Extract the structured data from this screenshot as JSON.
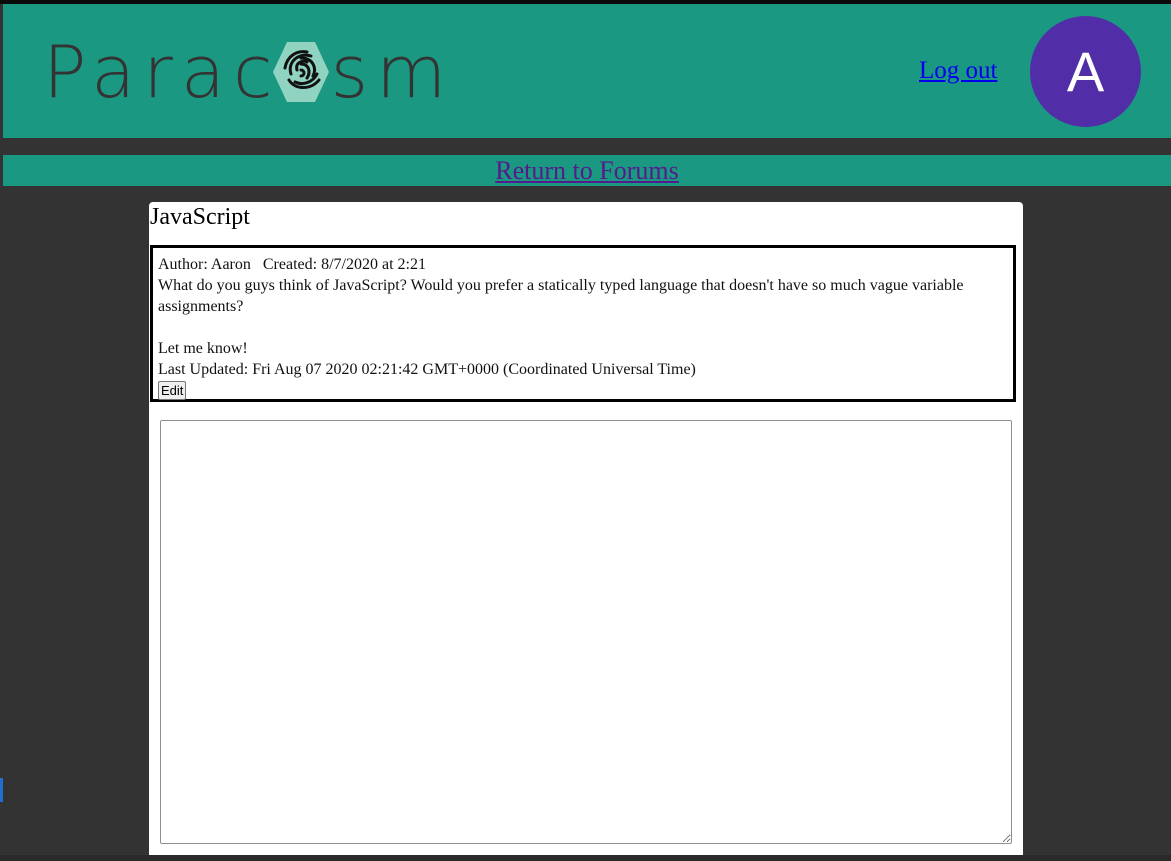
{
  "header": {
    "logo_text_left": "Para",
    "logo_text_right": "sm",
    "logout_label": "Log out",
    "avatar_initial": "A"
  },
  "nav": {
    "return_label": "Return to Forums"
  },
  "thread": {
    "title": "JavaScript",
    "post": {
      "author_line": "Author: Aaron",
      "created_line": "Created: 8/7/2020 at 2:21",
      "body_line_1": "What do you guys think of JavaScript? Would you prefer a statically typed language that doesn't have so much vague variable assignments?",
      "body_line_2": "Let me know!",
      "updated_line": "Last Updated: Fri Aug 07 2020 02:21:42 GMT+0000 (Coordinated Universal Time)",
      "edit_label": "Edit"
    }
  },
  "reply": {
    "value": ""
  },
  "colors": {
    "header_bg": "#1b9882",
    "page_bg": "#333333",
    "avatar_bg": "#512da8",
    "link": "#0000ee",
    "visited_link": "#551a8b"
  }
}
